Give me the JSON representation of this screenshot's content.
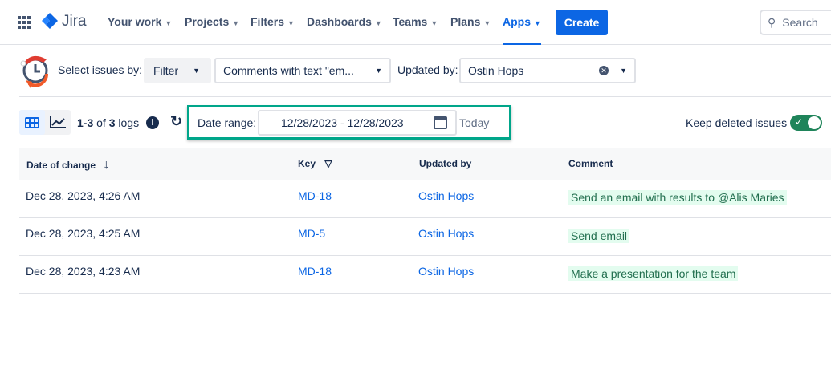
{
  "nav": {
    "logo": "Jira",
    "items": [
      "Your work",
      "Projects",
      "Filters",
      "Dashboards",
      "Teams",
      "Plans",
      "Apps"
    ],
    "active": "Apps",
    "create": "Create",
    "search_placeholder": "Search"
  },
  "filterbar": {
    "select_label": "Select issues by:",
    "mode": "Filter",
    "filter_value": "Comments with text \"em...",
    "updated_by_label": "Updated by:",
    "updated_by_value": "Ostin Hops"
  },
  "toolbar": {
    "count_range": "1-3",
    "count_of": "of",
    "count_total": "3",
    "count_unit": "logs",
    "date_range_label": "Date range:",
    "date_range_value": "12/28/2023 - 12/28/2023",
    "today": "Today",
    "keep_deleted": "Keep deleted issues",
    "keep_deleted_on": true,
    "accent": "#00a68a"
  },
  "table": {
    "headers": [
      "Date of change",
      "Key",
      "Updated by",
      "Comment"
    ],
    "rows": [
      {
        "date": "Dec 28, 2023, 4:26 AM",
        "key": "MD-18",
        "user": "Ostin Hops",
        "comment": "Send an email with results to @Alis Maries"
      },
      {
        "date": "Dec 28, 2023, 4:25 AM",
        "key": "MD-5",
        "user": "Ostin Hops",
        "comment": "Send email"
      },
      {
        "date": "Dec 28, 2023, 4:23 AM",
        "key": "MD-18",
        "user": "Ostin Hops",
        "comment": "Make a presentation for the team"
      }
    ]
  }
}
